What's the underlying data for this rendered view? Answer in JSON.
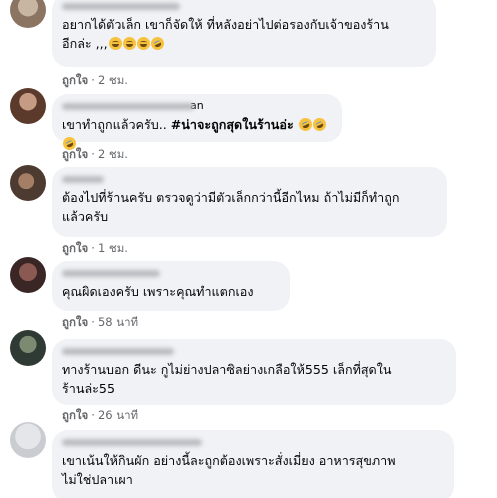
{
  "comments": [
    {
      "text_line1": "อยากได้ตัวเล็ก เขาก็จัดให้ ที่หลังอย่าไปต่อรองกับเจ้าของร้าน",
      "text_line2": "อีกล่ะ ,,,",
      "like_label": "ถูกใจ",
      "time": "2 ชม."
    },
    {
      "author_tail": "an",
      "text_plain": "เขาทำถูกแล้วครับ.. ",
      "text_hashtag": "#น่าจะถูกสุดในร้านอ่ะ",
      "like_label": "ถูกใจ",
      "time": "2 ชม."
    },
    {
      "text_line1": "ต้องไปที่ร้านครับ ตรวจดูว่ามีตัวเล็กกว่านี้อีกไหม ถ้าไม่มีก็ทำถูก",
      "text_line2": "แล้วครับ",
      "like_label": "ถูกใจ",
      "time": "1 ชม."
    },
    {
      "text_line1": "คุณผิดเองครับ เพราะคุณทำแตกเอง",
      "like_label": "ถูกใจ",
      "time": "58 นาที"
    },
    {
      "text_line1": "ทางร้านบอก ดีนะ กูไม่ย่างปลาซิลย่างเกลือให้555 เล็กที่สุดใน",
      "text_line2": "ร้านล่ะ55",
      "like_label": "ถูกใจ",
      "time": "26 นาที"
    },
    {
      "text_line1": "เขาเน้นให้กินผัก อย่างนี้ละถูกต้องเพราะสั่งเมี่ยง อาหารสุขภาพ",
      "text_line2": "ไม่ใช่ปลาเผา"
    }
  ],
  "separator": "·",
  "colors": {
    "bubble_bg": "#f0f2f5",
    "meta_text": "#65676b",
    "emoji_face": "#f7c23d"
  },
  "icons": {
    "emoji_grin": "grinning-face-icon",
    "emoji_rofl": "rofl-face-icon"
  }
}
